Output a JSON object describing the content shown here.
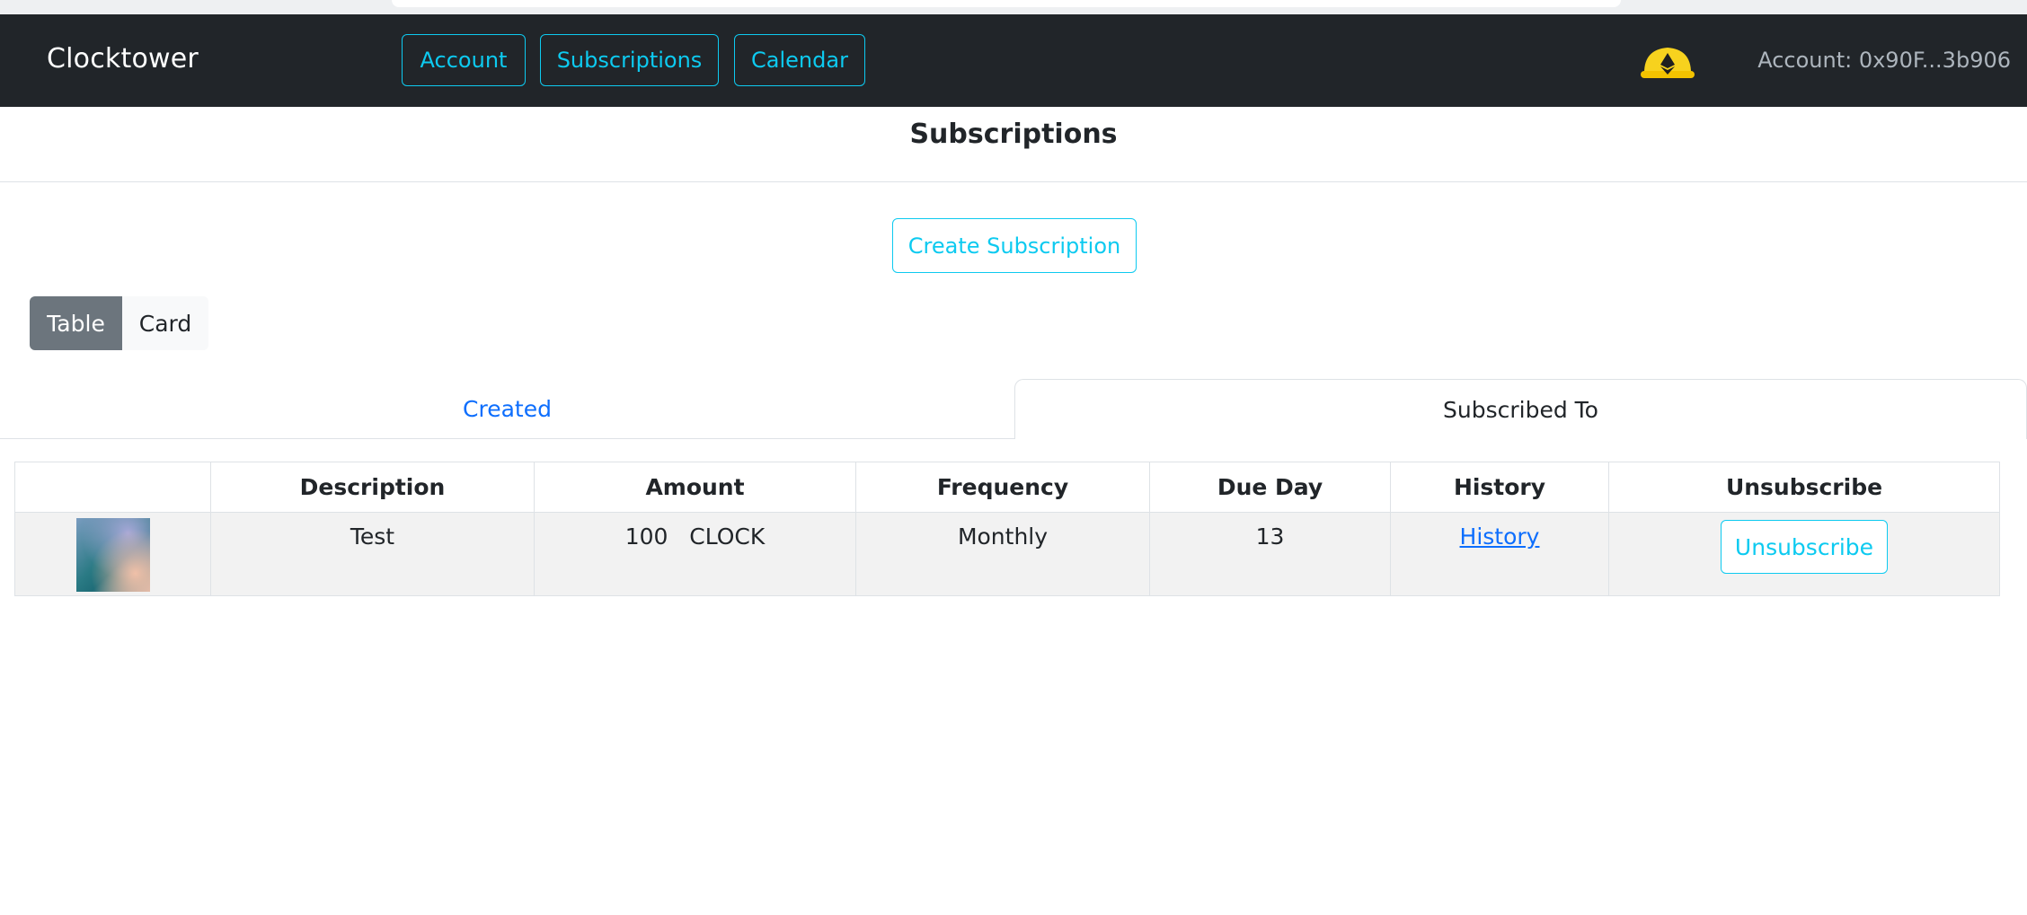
{
  "app": {
    "brand": "Clocktower"
  },
  "nav": {
    "account_label": "Account",
    "subscriptions_label": "Subscriptions",
    "calendar_label": "Calendar",
    "wallet_icon": "hardhat-ethereum-icon",
    "account_address": "Account: 0x90F...3b906"
  },
  "page": {
    "title": "Subscriptions"
  },
  "actions": {
    "create_label": "Create Subscription"
  },
  "view_toggle": {
    "table_label": "Table",
    "card_label": "Card",
    "selected": "Table"
  },
  "tabs": {
    "created_label": "Created",
    "subscribed_label": "Subscribed To",
    "active": "Subscribed To"
  },
  "table": {
    "headers": [
      "",
      "Description",
      "Amount",
      "Frequency",
      "Due Day",
      "History",
      "Unsubscribe"
    ],
    "rows": [
      {
        "description": "Test",
        "amount": "100",
        "token": "CLOCK",
        "frequency": "Monthly",
        "due_day": "13",
        "history_label": "History",
        "unsubscribe_label": "Unsubscribe"
      }
    ]
  },
  "colors": {
    "navbar": "#212529",
    "accent": "#0dcaf0",
    "link": "#0d6efd",
    "toggle_active": "#6c757d"
  }
}
